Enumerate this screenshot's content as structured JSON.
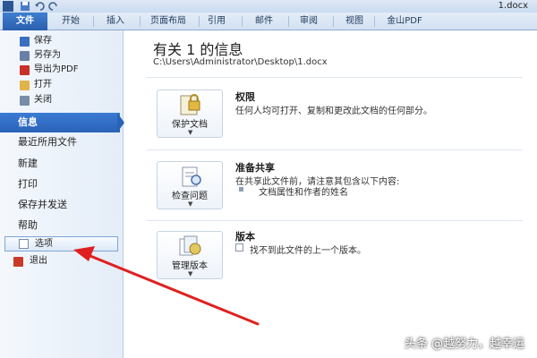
{
  "window": {
    "title": "1.docx"
  },
  "ribbon": {
    "tabs": [
      "文件",
      "开始",
      "插入",
      "页面布局",
      "引用",
      "邮件",
      "审阅",
      "视图",
      "金山PDF"
    ]
  },
  "backstage": {
    "commands": [
      {
        "label": "保存",
        "icon": "save-icon",
        "color": "#3a6fc2"
      },
      {
        "label": "另存为",
        "icon": "save-as-icon",
        "color": "#6a7fa8"
      },
      {
        "label": "导出为PDF",
        "icon": "pdf-icon",
        "color": "#c9302c"
      },
      {
        "label": "打开",
        "icon": "folder-open-icon",
        "color": "#e2b34a"
      },
      {
        "label": "关闭",
        "icon": "close-document-icon",
        "color": "#7a8ca8"
      }
    ],
    "nav": [
      "信息",
      "最近所用文件",
      "新建",
      "打印",
      "保存并发送",
      "帮助"
    ],
    "options_label": "选项",
    "exit_label": "退出"
  },
  "info": {
    "title": "有关 1 的信息",
    "path": "C:\\Users\\Administrator\\Desktop\\1.docx",
    "sections": [
      {
        "button": "保护文档",
        "icon": "lock-icon",
        "title": "权限",
        "desc": "任何人均可打开、复制和更改此文档的任何部分。"
      },
      {
        "button": "检查问题",
        "icon": "check-document-icon",
        "title": "准备共享",
        "desc": "在共享此文件前，请注意其包含以下内容:",
        "bullet": "文档属性和作者的姓名"
      },
      {
        "button": "管理版本",
        "icon": "versions-icon",
        "title": "版本",
        "desc": "找不到此文件的上一个版本。"
      }
    ]
  },
  "watermark": "头条 @越努力，越幸运",
  "colors": {
    "accent": "#2a62b8",
    "arrow": "#e02020"
  }
}
